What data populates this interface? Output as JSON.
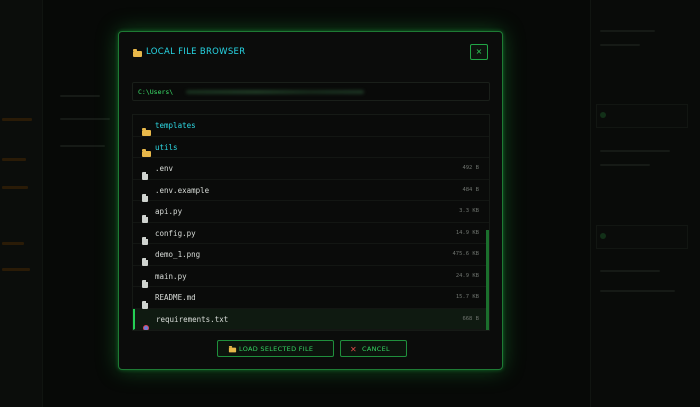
{
  "dialog": {
    "title": "LOCAL FILE BROWSER",
    "close_label": "×",
    "path_prefix": "C:\\Users\\"
  },
  "files": [
    {
      "name": "templates",
      "type": "folder",
      "size": ""
    },
    {
      "name": "utils",
      "type": "folder",
      "size": ""
    },
    {
      "name": ".env",
      "type": "file",
      "size": "492 B"
    },
    {
      "name": ".env.example",
      "type": "file",
      "size": "484 B"
    },
    {
      "name": "api.py",
      "type": "file",
      "size": "3.3 KB"
    },
    {
      "name": "config.py",
      "type": "file",
      "size": "14.9 KB"
    },
    {
      "name": "demo_1.png",
      "type": "file",
      "size": "475.6 KB"
    },
    {
      "name": "main.py",
      "type": "file",
      "size": "24.9 KB"
    },
    {
      "name": "README.md",
      "type": "file",
      "size": "15.7 KB"
    },
    {
      "name": "requirements.txt",
      "type": "file",
      "size": "668 B",
      "selected": true
    }
  ],
  "buttons": {
    "load_label": "LOAD SELECTED FILE",
    "cancel_label": "CANCEL"
  },
  "colors": {
    "accent_green": "#24d055",
    "title_cyan": "#27d7e6",
    "folder_yellow": "#e8b84a",
    "cancel_red": "#e04a4a"
  },
  "icons": {
    "folder": "folder-icon",
    "file": "file-icon",
    "target": "target-icon",
    "close": "close-icon"
  }
}
